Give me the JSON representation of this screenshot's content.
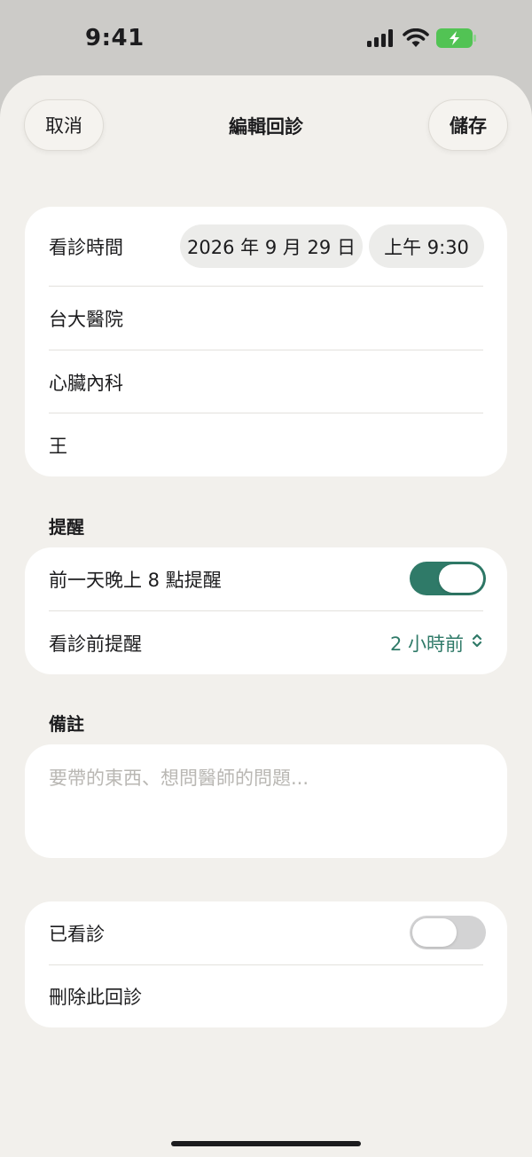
{
  "status_bar": {
    "time": "9:41"
  },
  "nav": {
    "cancel_label": "取消",
    "title": "編輯回診",
    "save_label": "儲存"
  },
  "appointment": {
    "time_label": "看診時間",
    "date": "2026 年 9 月 29 日",
    "time": "上午 9:30",
    "hospital": "台大醫院",
    "department": "心臟內科",
    "doctor": "王"
  },
  "reminders": {
    "section_title": "提醒",
    "night_before_label": "前一天晚上 8 點提醒",
    "night_before_enabled": true,
    "before_visit_label": "看診前提醒",
    "before_visit_value": "2 小時前"
  },
  "notes": {
    "section_title": "備註",
    "placeholder": "要帶的東西、想問醫師的問題..."
  },
  "status": {
    "visited_label": "已看診",
    "visited_enabled": false,
    "delete_label": "刪除此回診"
  },
  "colors": {
    "accent": "#2f7a68",
    "toggle_off": "#d3d3d4",
    "background": "#f2f0ec"
  },
  "icons": {
    "signal": "cellular-signal-icon",
    "wifi": "wifi-icon",
    "battery": "battery-charging-icon",
    "stepper": "chevron-updown-icon"
  }
}
